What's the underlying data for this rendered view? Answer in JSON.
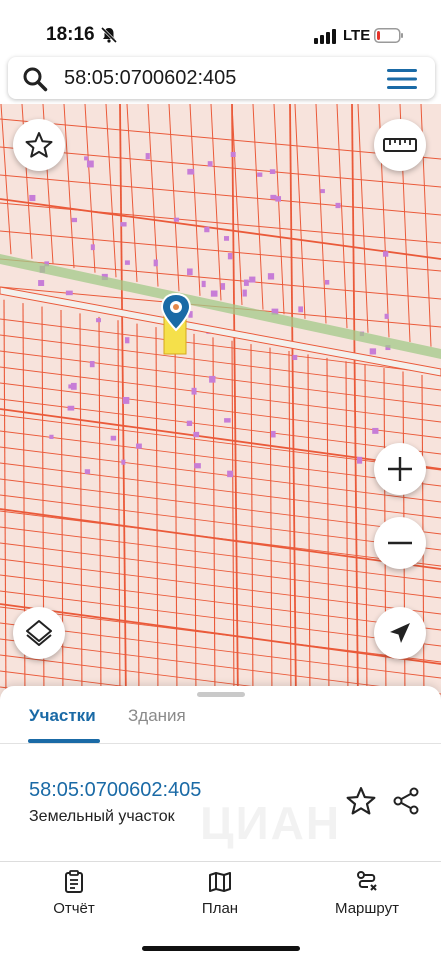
{
  "status_bar": {
    "time": "18:16",
    "network": "LTE",
    "bell_icon": "bell-slash-icon",
    "battery_level": 0.12,
    "battery_color": "#e5332a"
  },
  "search": {
    "query": "58:05:0700602:405",
    "search_icon": "search-icon",
    "menu_icon": "hamburger-menu-icon"
  },
  "map": {
    "colors": {
      "parcel_fill": "#f7e3dc",
      "parcel_line": "#ea5a3a",
      "building": "#c77dd7",
      "road_green": "#a3c98a",
      "selected_parcel": "#f5e04a",
      "marker": "#1a6aa6"
    },
    "buttons": {
      "favorite": "star-outline-icon",
      "ruler": "ruler-icon",
      "zoom_in": "plus-icon",
      "zoom_out": "minus-icon",
      "layers": "layers-icon",
      "locate": "navigation-arrow-icon"
    }
  },
  "sheet": {
    "tabs": [
      {
        "label": "Участки",
        "active": true
      },
      {
        "label": "Здания",
        "active": false
      }
    ],
    "parcel_number": "58:05:0700602:405",
    "parcel_type": "Земельный участок",
    "watermark": "ЦИАН"
  },
  "bottom_nav": {
    "items": [
      {
        "label": "Отчёт",
        "icon": "report-icon"
      },
      {
        "label": "План",
        "icon": "map-icon"
      },
      {
        "label": "Маршрут",
        "icon": "route-icon"
      }
    ]
  }
}
